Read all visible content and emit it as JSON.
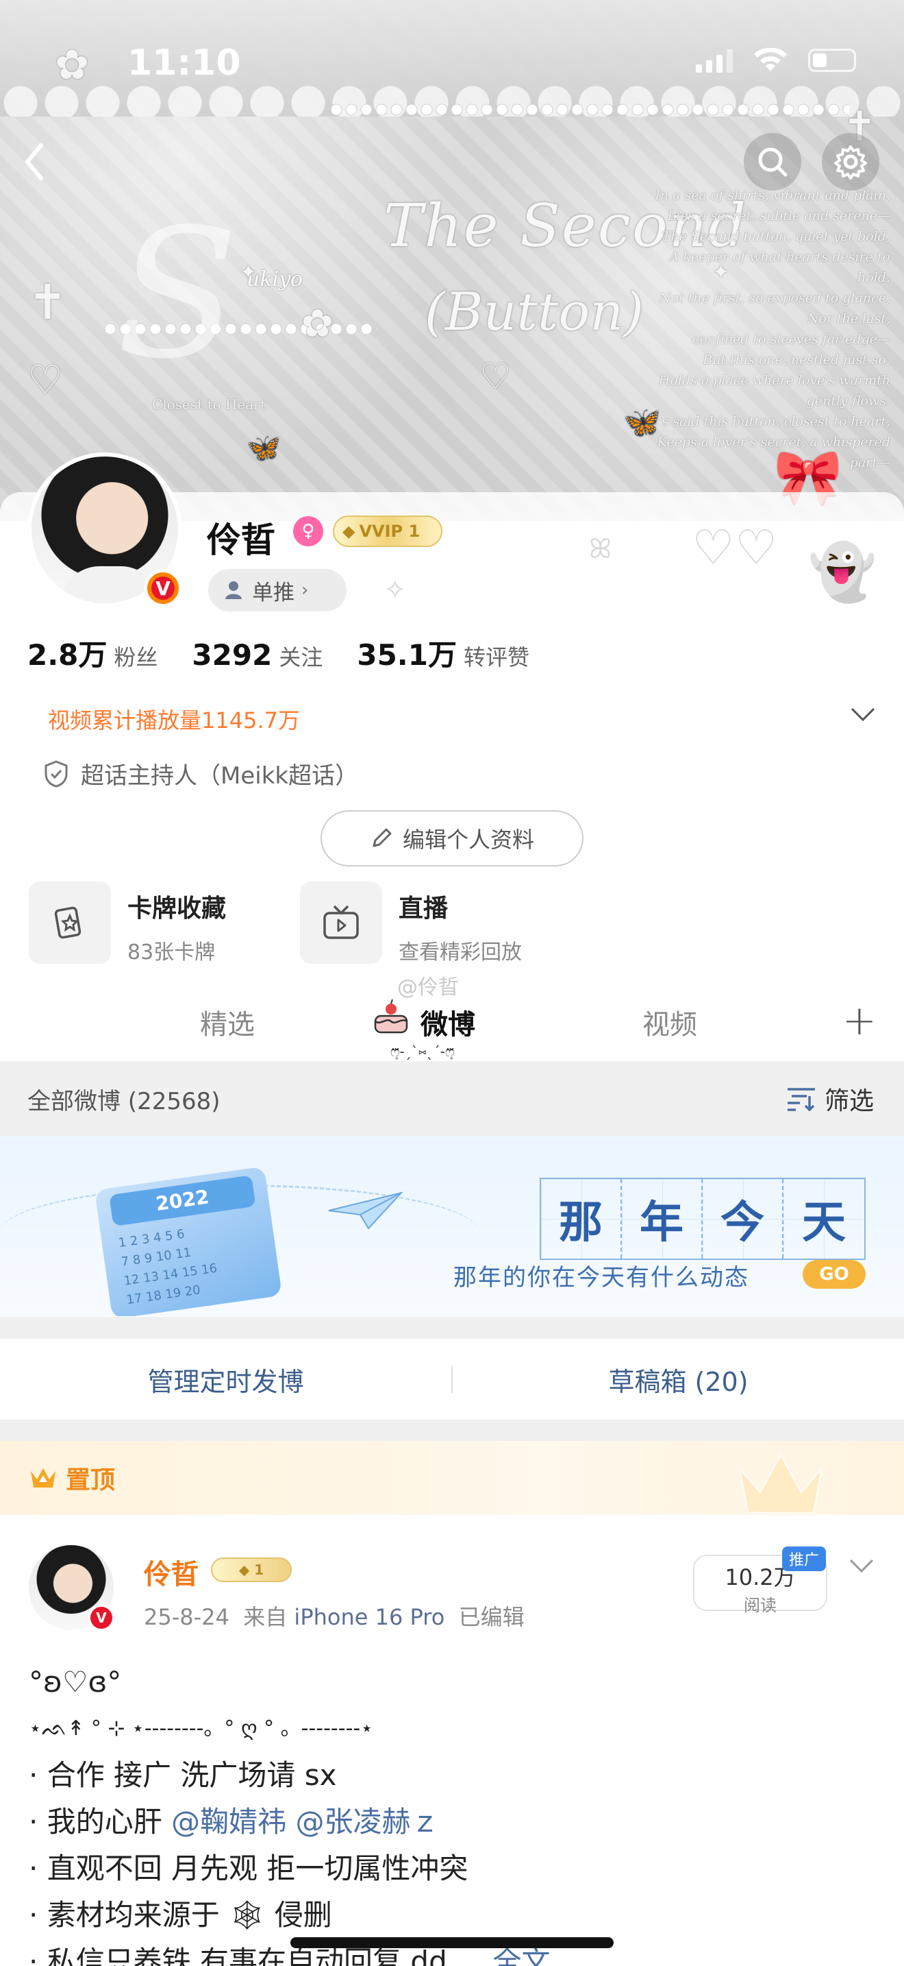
{
  "status_bar": {
    "time": "11:10"
  },
  "banner": {
    "title_line1": "The Second",
    "title_line2": "(Button)",
    "brand": "ukiyo",
    "caption": "Closest to Heart",
    "poem": [
      "In a sea of shirts, vibrant and plain,",
      "Lies a secret, subtle and serene—",
      "The Second button, quiet yet bold,",
      "A keeper of what hearts desire to hold.",
      "Not the first, so exposed to glance,",
      "Nor the last,",
      "confined to sleeves far edge—",
      "But this one, nestled just so,",
      "Holds a place where love's warmth gently flows.",
      "It's said this button, closest to heart,",
      "Keeps a lover's secret, a whispered part—"
    ]
  },
  "profile": {
    "name": "伶晢",
    "vip_label": "VVIP 1",
    "recommend_label": "单推",
    "stats": [
      {
        "value": "2.8万",
        "label": "粉丝"
      },
      {
        "value": "3292",
        "label": "关注"
      },
      {
        "value": "35.1万",
        "label": "转评赞"
      }
    ],
    "video_stat": "视频累计播放量1145.7万",
    "super_host": "超话主持人（Meikk超话）",
    "edit_label": "编辑个人资料",
    "features": [
      {
        "title": "卡牌收藏",
        "sub": "83张卡牌",
        "icon": "card-icon"
      },
      {
        "title": "直播",
        "sub": "查看精彩回放",
        "icon": "tv-icon"
      }
    ],
    "watermark": "@伶晢"
  },
  "tabs": [
    {
      "label": "精选",
      "active": false
    },
    {
      "label": "微博",
      "active": true
    },
    {
      "label": "视频",
      "active": false
    }
  ],
  "list_header": {
    "title": "全部微博 (22568)",
    "filter_label": "筛选"
  },
  "memory_banner": {
    "chars": [
      "那",
      "年",
      "今",
      "天"
    ],
    "subtitle": "那年的你在今天有什么动态",
    "go_label": "GO",
    "calendar_year": "2022",
    "calendar_digits": [
      "1 2 3 4 5 6",
      "7 8 9 10 11",
      "12 13 14 15 16",
      "17 18 19 20"
    ]
  },
  "manage": {
    "scheduled_label": "管理定时发博",
    "drafts_label": "草稿箱 (20)"
  },
  "pinned": {
    "label": "置顶"
  },
  "post": {
    "author": "伶晢",
    "vip_label": "1",
    "date": "25-8-24",
    "source_prefix": "来自",
    "source": "iPhone 16 Pro",
    "edited": "已编辑",
    "reads_count": "10.2万",
    "reads_label": "阅读",
    "promo_label": "推广",
    "lines": [
      {
        "text": "°ʚ♡ɞ°"
      },
      {
        "text": "⋆ᨒ↟ ° ⊹ ⋆--------。° ღ ° 。--------⋆"
      },
      {
        "text": "· 合作 接广 洗广场请 sx"
      },
      {
        "prefix": "· 我的心肝",
        "mention1": "@鞠婧祎",
        "mention2": "@张凌赫ｚ"
      },
      {
        "text": "· 直观不回 月先观 拒一切属性冲突"
      },
      {
        "prefix": "· 素材均来源于",
        "emoji": "🕸",
        "suffix": " 侵删"
      },
      {
        "prefix": "· 私信只养铁 有事在自动回复 dd ...",
        "more": "全文"
      }
    ]
  },
  "colors": {
    "accent_orange": "#ff7a2e",
    "link_blue": "#4b6fa3",
    "weibo_red": "#e6162d",
    "gold": "#e3c46a"
  }
}
